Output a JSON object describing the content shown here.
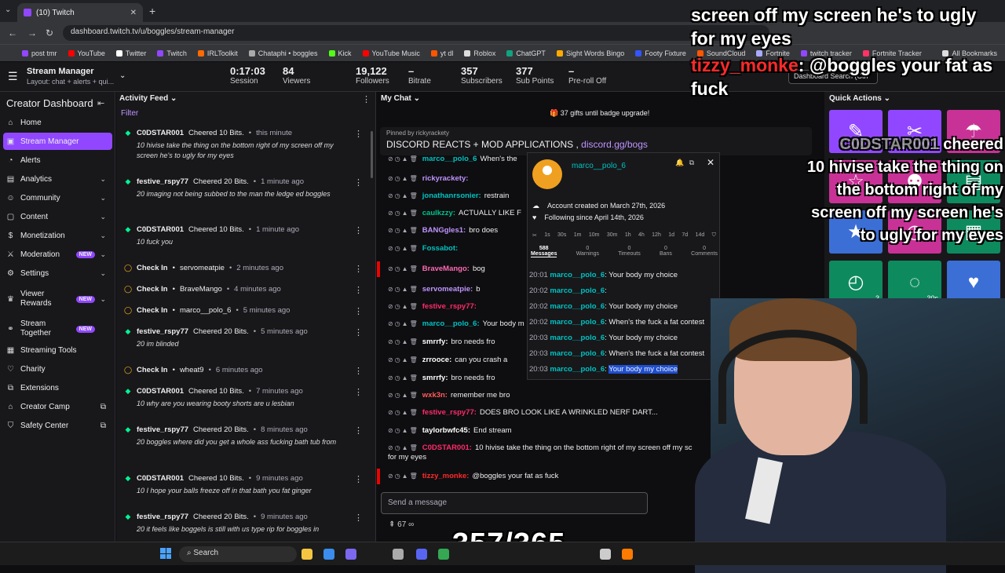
{
  "browser": {
    "tab_title": "(10) Twitch",
    "url": "dashboard.twitch.tv/u/boggles/stream-manager",
    "bookmarks": [
      {
        "label": "post tmr",
        "color": "#9147ff"
      },
      {
        "label": "YouTube",
        "color": "#ff0000"
      },
      {
        "label": "Twitter",
        "color": "#ffffff"
      },
      {
        "label": "Twitch",
        "color": "#9147ff"
      },
      {
        "label": "IRLToolkit",
        "color": "#ff6a00"
      },
      {
        "label": "Chataphi • boggles",
        "color": "#aaaaaa"
      },
      {
        "label": "Kick",
        "color": "#53fc18"
      },
      {
        "label": "YouTube Music",
        "color": "#ff0000"
      },
      {
        "label": "yt dl",
        "color": "#ff5500"
      },
      {
        "label": "Roblox",
        "color": "#dddddd"
      },
      {
        "label": "ChatGPT",
        "color": "#10a37f"
      },
      {
        "label": "Sight Words Bingo",
        "color": "#ffaa00"
      },
      {
        "label": "Footy Fixture",
        "color": "#3355ff"
      },
      {
        "label": "SoundCloud",
        "color": "#ff5500"
      },
      {
        "label": "Fortnite",
        "color": "#aaaaff"
      },
      {
        "label": "twitch tracker",
        "color": "#9147ff"
      },
      {
        "label": "Fortnite Tracker",
        "color": "#ff3366"
      },
      {
        "label": "All Bookmarks",
        "color": "#dddddd"
      }
    ]
  },
  "topbar": {
    "title": "Stream Manager",
    "layout": "Layout: chat + alerts + qui...",
    "stats": [
      {
        "value": "0:17:03",
        "label": "Session"
      },
      {
        "value": "84",
        "label": "Viewers"
      },
      {
        "value": "19,122",
        "label": "Followers"
      },
      {
        "value": "–",
        "label": "Bitrate"
      },
      {
        "value": "357",
        "label": "Subscribers"
      },
      {
        "value": "377",
        "label": "Sub Points"
      },
      {
        "value": "–",
        "label": "Pre-roll Off"
      }
    ],
    "search_placeholder": "Dashboard Search (Ctrl"
  },
  "sidebar": {
    "title": "Creator Dashboard",
    "items": [
      {
        "label": "Home",
        "icon": "home-icon",
        "glyph": "⌂"
      },
      {
        "label": "Stream Manager",
        "icon": "stream-manager-icon",
        "glyph": "▣",
        "active": true
      },
      {
        "label": "Alerts",
        "icon": "alerts-icon",
        "glyph": "◔"
      },
      {
        "label": "Analytics",
        "icon": "analytics-icon",
        "glyph": "▤",
        "chev": true
      },
      {
        "label": "Community",
        "icon": "community-icon",
        "glyph": "☺",
        "chev": true
      },
      {
        "label": "Content",
        "icon": "content-icon",
        "glyph": "▢",
        "chev": true
      },
      {
        "label": "Monetization",
        "icon": "monetization-icon",
        "glyph": "$",
        "chev": true
      },
      {
        "label": "Moderation",
        "icon": "moderation-icon",
        "glyph": "⚔",
        "chev": true,
        "new": "NEW"
      },
      {
        "label": "Settings",
        "icon": "settings-icon",
        "glyph": "⚙",
        "chev": true
      },
      {
        "label": "Viewer Rewards",
        "icon": "viewer-rewards-icon",
        "glyph": "♛",
        "chev": true,
        "new": "NEW"
      },
      {
        "label": "Stream Together",
        "icon": "stream-together-icon",
        "glyph": "⚭",
        "new": "NEW"
      },
      {
        "label": "Streaming Tools",
        "icon": "streaming-tools-icon",
        "glyph": "▦"
      },
      {
        "label": "Charity",
        "icon": "charity-icon",
        "glyph": "♡"
      },
      {
        "label": "Extensions",
        "icon": "extensions-icon",
        "glyph": "⧉"
      },
      {
        "label": "Creator Camp",
        "icon": "creator-camp-icon",
        "glyph": "⌂",
        "ext": true
      },
      {
        "label": "Safety Center",
        "icon": "safety-center-icon",
        "glyph": "⛉",
        "ext": true
      }
    ]
  },
  "activity": {
    "title": "Activity Feed",
    "filter": "Filter",
    "events": [
      {
        "user": "C0DSTAR001",
        "action": "Cheered 10 Bits.",
        "time": "this minute",
        "type": "cheer",
        "msg": "10 hivise take the thing on the bottom right of my screen off my screen he's to ugly for my eyes"
      },
      {
        "user": "festive_rspy77",
        "action": "Cheered 20 Bits.",
        "time": "1 minute ago",
        "type": "cheer",
        "msg": "20 imaging not being subbed to the man the ledge ed boggles"
      },
      {
        "user": "C0DSTAR001",
        "action": "Cheered 10 Bits.",
        "time": "1 minute ago",
        "type": "cheer",
        "msg": "10 fuck you"
      },
      {
        "user": "Check In",
        "action": "servomeatpie",
        "time": "2 minutes ago",
        "type": "check",
        "msg": ""
      },
      {
        "user": "Check In",
        "action": "BraveMango",
        "time": "4 minutes ago",
        "type": "check",
        "msg": ""
      },
      {
        "user": "Check In",
        "action": "marco__polo_6",
        "time": "5 minutes ago",
        "type": "check",
        "msg": ""
      },
      {
        "user": "festive_rspy77",
        "action": "Cheered 20 Bits.",
        "time": "5 minutes ago",
        "type": "cheer",
        "msg": "20 im blinded"
      },
      {
        "user": "Check In",
        "action": "wheat9",
        "time": "6 minutes ago",
        "type": "check",
        "msg": ""
      },
      {
        "user": "C0DSTAR001",
        "action": "Cheered 10 Bits.",
        "time": "7 minutes ago",
        "type": "cheer",
        "msg": "10 why are you wearing booty shorts are u lesbian"
      },
      {
        "user": "festive_rspy77",
        "action": "Cheered 20 Bits.",
        "time": "8 minutes ago",
        "type": "cheer",
        "msg": "20 boggles where did you get a whole ass fucking bath tub from"
      },
      {
        "user": "C0DSTAR001",
        "action": "Cheered 10 Bits.",
        "time": "9 minutes ago",
        "type": "cheer",
        "msg": "10 I hope your balls freeze off in that bath you fat ginger"
      },
      {
        "user": "festive_rspy77",
        "action": "Cheered 20 Bits.",
        "time": "9 minutes ago",
        "type": "cheer",
        "msg": "20 it feels like boggels is still with us type rip for boggles in"
      }
    ]
  },
  "chat": {
    "title": "My Chat",
    "badge_banner": "37 gifts until badge upgrade!",
    "pinned_by": "Pinned by rickyrackety",
    "pinned_text": "DISCORD REACTS + MOD APPLICATIONS ,",
    "pinned_link": "discord.gg/bogs",
    "lines": [
      {
        "user": "marco__polo_6",
        "text": "When's the",
        "color": "#00c2c2"
      },
      {
        "user": "rickyrackety:",
        "text": "",
        "color": "#bf94ff"
      },
      {
        "user": "jonathanrsonier:",
        "text": "restrain",
        "color": "#00c2c2"
      },
      {
        "user": "caulkzzy:",
        "text": "ACTUALLY LIKE F",
        "color": "#00c28a"
      },
      {
        "user": "BANGgles1:",
        "text": "bro does",
        "color": "#bf94ff"
      },
      {
        "user": "Fossabot:",
        "text": "",
        "color": "#00c2c2"
      },
      {
        "user": "BraveMango:",
        "text": "bog",
        "color": "#ff69b4",
        "red": true
      },
      {
        "user": "servomeatpie:",
        "text": "b",
        "color": "#bf94ff"
      },
      {
        "user": "festive_rspy77:",
        "text": "",
        "color": "#ff2a6a"
      },
      {
        "user": "marco__polo_6:",
        "text": "Your body m",
        "color": "#00c2c2"
      },
      {
        "user": "smrrfy:",
        "text": "bro needs fro",
        "color": "#ffffff"
      },
      {
        "user": "zrrooce:",
        "text": "can you crash a",
        "color": "#ffffff"
      },
      {
        "user": "smrrfy:",
        "text": "bro needs fro",
        "color": "#ffffff"
      },
      {
        "user": "wxk3n:",
        "text": "remember me bro",
        "color": "#ff5a5a"
      },
      {
        "user": "festive_rspy77:",
        "text": "DOES BRO LOOK LIKE A WRINKLED NERF DART...",
        "color": "#ff2a6a"
      },
      {
        "user": "taylorbwfc45:",
        "text": "End stream",
        "color": "#ffffff"
      },
      {
        "user": "C0DSTAR001:",
        "text": "10 hivise take the thing on the bottom right of my screen off my sc",
        "color": "#ff2a6a"
      },
      {
        "user": "tizzy_monke:",
        "text": "@boggles your fat as fuck",
        "color": "#ff2a2a",
        "red": true
      }
    ],
    "wrap_text": "for my eyes",
    "input_placeholder": "Send a message",
    "footer": "67"
  },
  "usercard": {
    "username": "marco__polo_6",
    "created": "Account created on March 27th, 2026",
    "following": "Following since April 14th, 2026",
    "timeouts": [
      "1s",
      "30s",
      "1m",
      "10m",
      "30m",
      "1h",
      "4h",
      "12h",
      "1d",
      "7d",
      "14d"
    ],
    "tabs": [
      {
        "count": "588",
        "label": "Messages",
        "active": true
      },
      {
        "count": "0",
        "label": "Warnings"
      },
      {
        "count": "0",
        "label": "Timeouts"
      },
      {
        "count": "0",
        "label": "Bans"
      },
      {
        "count": "0",
        "label": "Comments"
      }
    ],
    "messages": [
      {
        "time": "20:01",
        "text": "Your body my choice"
      },
      {
        "time": "20:02",
        "text": ""
      },
      {
        "time": "20:02",
        "text": "Your body my choice"
      },
      {
        "time": "20:02",
        "text": "When's the fuck a fat contest"
      },
      {
        "time": "20:03",
        "text": "Your body my choice"
      },
      {
        "time": "20:03",
        "text": "When's the fuck a fat contest"
      },
      {
        "time": "20:03",
        "text": "Your body my choice",
        "hl": true
      }
    ]
  },
  "quick": {
    "title": "Quick Actions",
    "tiles": [
      {
        "icon": "pencil-icon",
        "glyph": "✎",
        "color": "#9147ff"
      },
      {
        "icon": "clip-icon",
        "glyph": "✂",
        "color": "#9147ff"
      },
      {
        "icon": "ad-icon",
        "glyph": "☂",
        "color": "#c83296"
      },
      {
        "icon": "star-icon",
        "glyph": "☆",
        "color": "#c83296"
      },
      {
        "icon": "add-mod-icon",
        "glyph": "⚉",
        "color": "#c83296"
      },
      {
        "icon": "prediction-icon",
        "glyph": "▤",
        "color": "#0e8a5f"
      },
      {
        "icon": "raid-icon",
        "glyph": "★",
        "color": "#3c6fd6"
      },
      {
        "icon": "slow-mode-icon",
        "glyph": "◷",
        "color": "#c83296"
      },
      {
        "icon": "poll-icon",
        "glyph": "▦",
        "color": "#0e8a5f"
      },
      {
        "icon": "timer-icon",
        "glyph": "◴",
        "color": "#0e8a5f",
        "label": "3"
      },
      {
        "icon": "cooldown-icon",
        "glyph": "◌",
        "color": "#0e8a5f",
        "label": "30s"
      },
      {
        "icon": "shield-icon",
        "glyph": "♥",
        "color": "#3c6fd6"
      },
      {
        "icon": "hat-icon",
        "glyph": "♜",
        "color": "#0e8a5f"
      },
      {
        "icon": "add-icon",
        "glyph": "+",
        "color": "#18181b"
      }
    ]
  },
  "overlay": {
    "line1": "screen off my screen he's to ugly for my eyes",
    "user2": "tizzy_monke",
    "line2": ": @boggles your fat as fuck",
    "line3_user": "C0DSTAR001",
    "line3": "cheered",
    "line4": "10 hivise take the thing on the bottom right of my screen off my screen he's to ugly for my eyes",
    "counter": "357/365"
  },
  "taskbar": {
    "search": "Search"
  }
}
